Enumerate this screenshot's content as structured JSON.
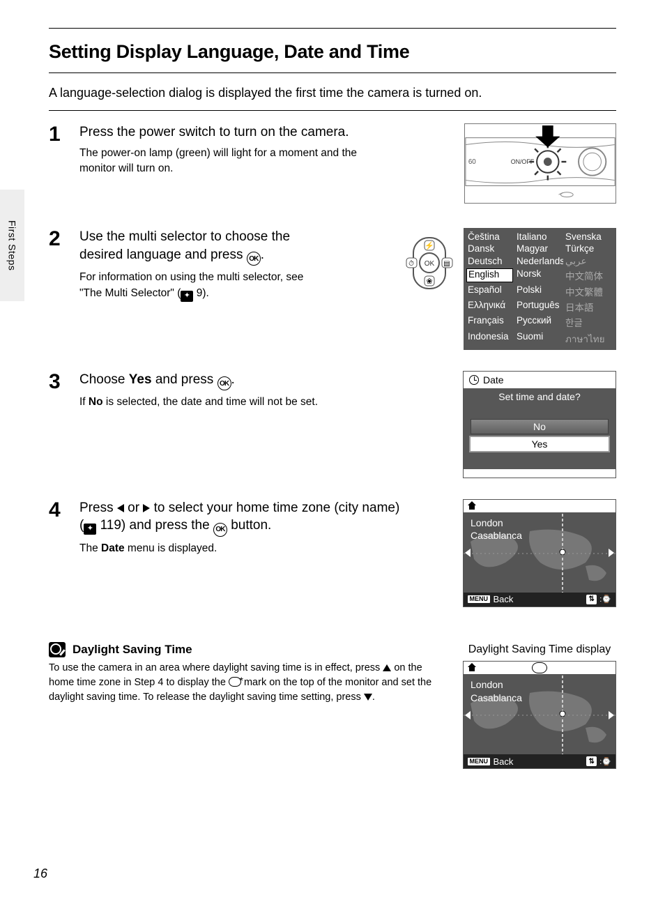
{
  "sideTab": "First Steps",
  "title": "Setting Display Language, Date and Time",
  "intro": "A language-selection dialog is displayed the first time the camera is turned on.",
  "onoff_label": "ON/OFF",
  "camera_label": "60",
  "steps": {
    "s1": {
      "num": "1",
      "head": "Press the power switch to turn on the camera.",
      "sub": "The power-on lamp (green) will light for a moment and the monitor will turn on."
    },
    "s2": {
      "num": "2",
      "head_a": "Use the multi selector to choose the desired language and press ",
      "head_b": ".",
      "sub_a": "For information on using the multi selector, see \"The Multi Selector\" (",
      "sub_b": " 9)."
    },
    "s3": {
      "num": "3",
      "head_a": "Choose ",
      "head_yes": "Yes",
      "head_b": " and press ",
      "head_c": ".",
      "sub_a": "If ",
      "sub_no": "No",
      "sub_b": " is selected, the date and time will not be set."
    },
    "s4": {
      "num": "4",
      "head_a": "Press ",
      "head_b": " or ",
      "head_c": " to select your home time zone (city name) (",
      "head_d": " 119) and press the ",
      "head_e": " button.",
      "sub_a": "The ",
      "sub_date": "Date",
      "sub_b": " menu is displayed."
    }
  },
  "ok_label": "OK",
  "multi_ok": "OK",
  "languages": {
    "col1": [
      "Čeština",
      "Dansk",
      "Deutsch",
      "English",
      "Español",
      "Ελληνικά",
      "Français",
      "Indonesia"
    ],
    "col2": [
      "Italiano",
      "Magyar",
      "Nederlands",
      "Norsk",
      "Polski",
      "Português",
      "Русский",
      "Suomi"
    ],
    "col3": [
      "Svenska",
      "Türkçe",
      "عربي",
      "中文简体",
      "中文繁體",
      "日本語",
      "한글",
      "ภาษาไทย"
    ],
    "selected": "English"
  },
  "dateDialog": {
    "title": "Date",
    "question": "Set time and date?",
    "no": "No",
    "yes": "Yes"
  },
  "tz": {
    "city1": "London",
    "city2": "Casablanca",
    "menu": "MENU",
    "back": "Back"
  },
  "dst": {
    "title": "Daylight Saving Time",
    "caption": "Daylight Saving Time display",
    "text_a": "To use the camera in an area where daylight saving time is in effect, press ",
    "text_b": " on the home time zone in Step 4 to display the ",
    "text_c": " mark on the top of the monitor and set the daylight saving time. To release the daylight saving time setting, press ",
    "text_d": "."
  },
  "pageNumber": "16"
}
